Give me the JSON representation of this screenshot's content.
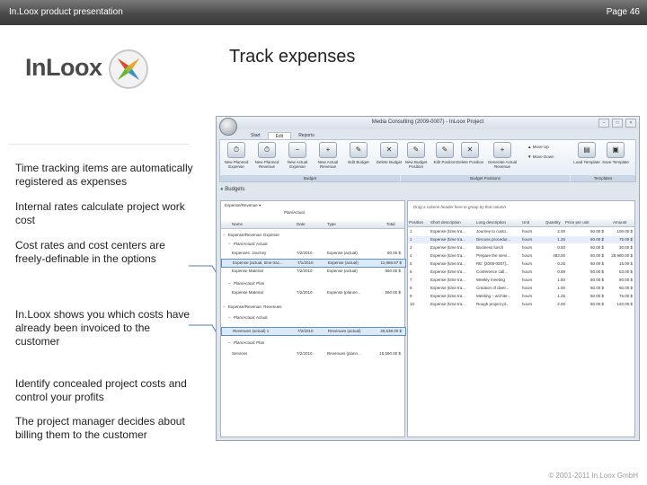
{
  "header": {
    "left": "In.Loox product presentation",
    "right": "Page 46"
  },
  "logo": {
    "text": "InLoox"
  },
  "title": "Track expenses",
  "notes": [
    "Time tracking items are automatically registered as expenses",
    "Internal rates calculate project work cost",
    "Cost rates and cost centers are freely-definable in the options",
    "In.Loox shows you which costs have already been invoiced to the customer",
    "Identify concealed project costs and control your profits",
    "The project manager decides about billing them to the customer"
  ],
  "footer": "© 2001-2011 In.Loox GmbH",
  "app": {
    "window_title": "Mediа Consulting (2009-0007) - InLoox Project",
    "tabs": [
      "Start",
      "Edit",
      "Reports"
    ],
    "ribbon": {
      "budget_buttons": [
        "New Planned Expense",
        "New Planned Revenue",
        "New Actual Expense",
        "New Actual Revenue",
        "Edit Budget",
        "Delete Budget"
      ],
      "position_buttons": [
        "New Budget Position",
        "Edit Position",
        "Delete Position",
        "Generate Actual Revenue"
      ],
      "move_up": "Move Up",
      "move_down": "Move Down",
      "template_buttons": [
        "Load Template",
        "Save Template"
      ],
      "groups": [
        "Budget",
        "Budget Positions",
        "Templates"
      ]
    },
    "budgets_label": "Budgets",
    "left_grid": {
      "filter": "Expense/Revenue",
      "filter2": "Plan/Actual",
      "columns": [
        "Name",
        "Date",
        "Type",
        "Total"
      ],
      "rows": [
        {
          "kind": "group",
          "text": "Expense/Revenue: Expense"
        },
        {
          "kind": "subgroup",
          "text": "Plan/Actual: Actual"
        },
        {
          "kind": "row",
          "name": "Expenses: Journey",
          "date": "7/2/2010",
          "type": "Expense (actual)",
          "total": "80.00 $"
        },
        {
          "kind": "row",
          "name": "Expense (actual, time trac...",
          "date": "7/1/2010",
          "type": "Expense (actual)",
          "total": "11,668.67 $"
        },
        {
          "kind": "row",
          "name": "Expense Material",
          "date": "7/2/2010",
          "type": "Expense (actual)",
          "total": "660.00 $"
        },
        {
          "kind": "subgroup",
          "text": "Plan/Actual: Plan"
        },
        {
          "kind": "row",
          "name": "Expense Material",
          "date": "7/2/2010",
          "type": "Expense (planne...",
          "total": "560.00 $"
        },
        {
          "kind": "group",
          "text": "Expense/Revenue: Revenues"
        },
        {
          "kind": "subgroup",
          "text": "Plan/Actual: Actual"
        },
        {
          "kind": "row",
          "name": "Revenues (actual) 1",
          "date": "7/2/2010",
          "type": "Revenues (actual)",
          "total": "29,538.00 $"
        },
        {
          "kind": "subgroup",
          "text": "Plan/Actual: Plan"
        },
        {
          "kind": "row",
          "name": "Services",
          "date": "7/2/2010",
          "type": "Revenues (plann...",
          "total": "15,560.00 $"
        }
      ]
    },
    "right_grid": {
      "hint": "Drag a column header here to group by that column",
      "columns": [
        "Position",
        "Short description",
        "Long description",
        "Unit",
        "Quantity",
        "Price per unit",
        "Amount"
      ],
      "rows": [
        [
          "1",
          "Expense (time tra...",
          "Journey to custo...",
          "hours",
          "2.00",
          "50.00 $",
          "100.00 $"
        ],
        [
          "1",
          "Expense (time tra...",
          "Discuss procedur...",
          "hours",
          "1.25",
          "60.00 $",
          "75.00 $"
        ],
        [
          "3",
          "Expense (time tra...",
          "Business lunch",
          "hours",
          "0.50",
          "60.00 $",
          "30.00 $"
        ],
        [
          "4",
          "Expense (time tra...",
          "Prepare the servi...",
          "hours",
          "483.00",
          "60.00 $",
          "28,980.00 $"
        ],
        [
          "5",
          "Expense (time tra...",
          "RE: [2009-0007]...",
          "hours",
          "0.25",
          "60.00 $",
          "15.00 $"
        ],
        [
          "6",
          "Expense (time tra...",
          "Conference call...",
          "hours",
          "0.88",
          "60.00 $",
          "53.00 $"
        ],
        [
          "7",
          "Expense (time tra...",
          "Weekly meeting",
          "hours",
          "1.50",
          "60.00 $",
          "90.00 $"
        ],
        [
          "8",
          "Expense (time tra...",
          "Creation of diver...",
          "hours",
          "1.00",
          "60.00 $",
          "60.00 $"
        ],
        [
          "9",
          "Expense (time tra...",
          "Meeting – archite...",
          "hours",
          "1.25",
          "60.00 $",
          "75.00 $"
        ],
        [
          "10",
          "Expense (time tra...",
          "Rough project pl...",
          "hours",
          "2.00",
          "60.00 $",
          "120.00 $"
        ]
      ]
    }
  }
}
